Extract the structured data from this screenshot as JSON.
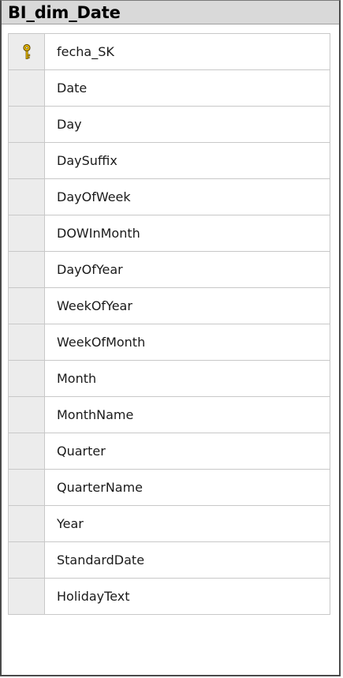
{
  "window": {
    "title": "BI_dim_Date"
  },
  "columns": [
    {
      "name": "fecha_SK",
      "icon": "primary-key-icon",
      "is_primary_key": true
    },
    {
      "name": "Date",
      "is_primary_key": false
    },
    {
      "name": "Day",
      "is_primary_key": false
    },
    {
      "name": "DaySuffix",
      "is_primary_key": false
    },
    {
      "name": "DayOfWeek",
      "is_primary_key": false
    },
    {
      "name": "DOWInMonth",
      "is_primary_key": false
    },
    {
      "name": "DayOfYear",
      "is_primary_key": false
    },
    {
      "name": "WeekOfYear",
      "is_primary_key": false
    },
    {
      "name": "WeekOfMonth",
      "is_primary_key": false
    },
    {
      "name": "Month",
      "is_primary_key": false
    },
    {
      "name": "MonthName",
      "is_primary_key": false
    },
    {
      "name": "Quarter",
      "is_primary_key": false
    },
    {
      "name": "QuarterName",
      "is_primary_key": false
    },
    {
      "name": "Year",
      "is_primary_key": false
    },
    {
      "name": "StandardDate",
      "is_primary_key": false
    },
    {
      "name": "HolidayText",
      "is_primary_key": false
    }
  ],
  "colors": {
    "title_bar": "#d9d9d9",
    "selector": "#ececec",
    "grid_line": "#c8c8c8",
    "key_gold": "#e8b800"
  }
}
